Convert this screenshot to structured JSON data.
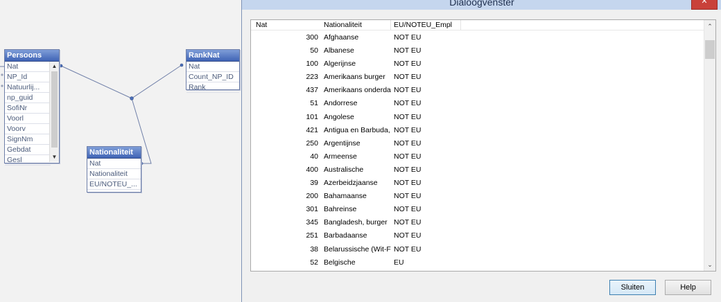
{
  "schema": {
    "tables": {
      "persoons": {
        "title": "Persoons",
        "fields": [
          "Nat",
          "NP_Id",
          "Natuurlij...",
          "np_guid",
          "SofiNr",
          "Voorl",
          "Voorv",
          "SignNm",
          "Gebdat",
          "Gesl"
        ]
      },
      "ranknat": {
        "title": "RankNat",
        "fields": [
          "Nat",
          "Count_NP_ID",
          "Rank"
        ]
      },
      "nationaliteit": {
        "title": "Nationaliteit",
        "fields": [
          "Nat",
          "Nationaliteit",
          "EU/NOTEU_..."
        ]
      }
    }
  },
  "dialog": {
    "title": "Dialoogvenster",
    "close_label": "✕",
    "columns": [
      "Nat",
      "Nationaliteit",
      "EU/NOTEU_Empl"
    ],
    "rows": [
      {
        "nat": "300",
        "name": "Afghaanse",
        "eu": "NOT EU"
      },
      {
        "nat": "50",
        "name": "Albanese",
        "eu": "NOT EU"
      },
      {
        "nat": "100",
        "name": "Algerijnse",
        "eu": "NOT EU"
      },
      {
        "nat": "223",
        "name": "Amerikaans burger",
        "eu": "NOT EU"
      },
      {
        "nat": "437",
        "name": "Amerikaans onderda",
        "eu": "NOT EU"
      },
      {
        "nat": "51",
        "name": "Andorrese",
        "eu": "NOT EU"
      },
      {
        "nat": "101",
        "name": "Angolese",
        "eu": "NOT EU"
      },
      {
        "nat": "421",
        "name": "Antigua en Barbuda,",
        "eu": "NOT EU"
      },
      {
        "nat": "250",
        "name": "Argentijnse",
        "eu": "NOT EU"
      },
      {
        "nat": "40",
        "name": "Armeense",
        "eu": "NOT EU"
      },
      {
        "nat": "400",
        "name": "Australische",
        "eu": "NOT EU"
      },
      {
        "nat": "39",
        "name": "Azerbeidzjaanse",
        "eu": "NOT EU"
      },
      {
        "nat": "200",
        "name": "Bahamaanse",
        "eu": "NOT EU"
      },
      {
        "nat": "301",
        "name": "Bahreinse",
        "eu": "NOT EU"
      },
      {
        "nat": "345",
        "name": "Bangladesh,  burger",
        "eu": "NOT EU"
      },
      {
        "nat": "251",
        "name": "Barbadaanse",
        "eu": "NOT EU"
      },
      {
        "nat": "38",
        "name": "Belarussische (Wit-F",
        "eu": "NOT EU"
      },
      {
        "nat": "52",
        "name": "Belgische",
        "eu": "EU"
      }
    ],
    "buttons": {
      "close": "Sluiten",
      "help": "Help"
    }
  },
  "icons": {
    "scroll_up": "chevron-up-icon",
    "scroll_down": "chevron-down-icon",
    "close": "close-icon"
  }
}
